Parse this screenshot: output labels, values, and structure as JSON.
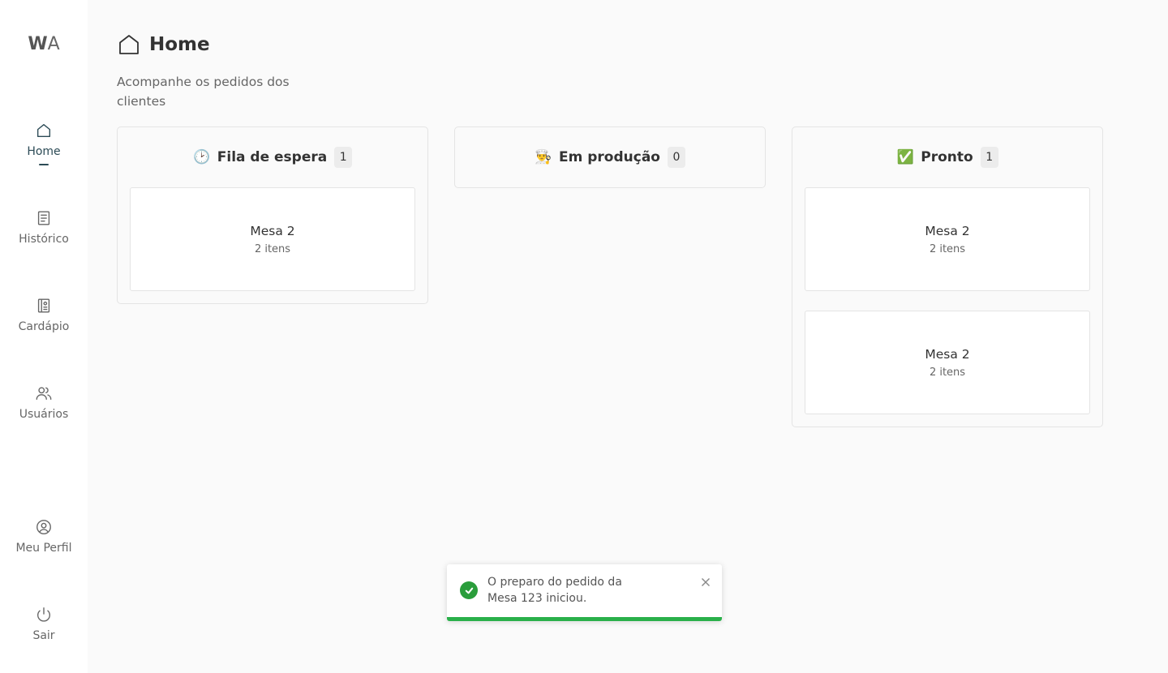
{
  "app": {
    "logo_w": "W",
    "logo_a": "A"
  },
  "sidebar": {
    "items": [
      {
        "label": "Home",
        "icon": "home-icon",
        "active": true
      },
      {
        "label": "Histórico",
        "icon": "receipt-icon",
        "active": false
      },
      {
        "label": "Cardápio",
        "icon": "menu-book-icon",
        "active": false
      },
      {
        "label": "Usuários",
        "icon": "users-icon",
        "active": false
      }
    ],
    "bottom_items": [
      {
        "label": "Meu Perfil",
        "icon": "user-circle-icon"
      },
      {
        "label": "Sair",
        "icon": "power-icon"
      }
    ]
  },
  "header": {
    "title": "Home",
    "subtitle": "Acompanhe os pedidos dos clientes"
  },
  "columns": [
    {
      "emoji": "🕑",
      "title": "Fila de espera",
      "count": "1",
      "orders": [
        {
          "table": "Mesa 2",
          "items": "2 itens"
        }
      ]
    },
    {
      "emoji": "👨‍🍳",
      "title": "Em produção",
      "count": "0",
      "orders": []
    },
    {
      "emoji": "✅",
      "title": "Pronto",
      "count": "1",
      "orders": [
        {
          "table": "Mesa 2",
          "items": "2 itens"
        },
        {
          "table": "Mesa 2",
          "items": "2 itens"
        }
      ]
    }
  ],
  "toast": {
    "message": "O preparo do pedido da Mesa 123 iniciou.",
    "progress": 1.0,
    "color": "#2ab04a",
    "icon": "check-circle-icon"
  },
  "colors": {
    "accent": "#2c4b56",
    "success": "#2a9d3b"
  }
}
